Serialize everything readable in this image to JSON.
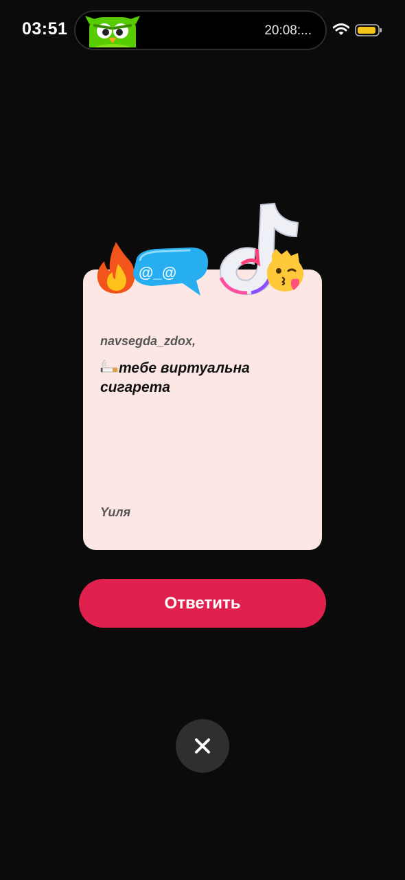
{
  "status_bar": {
    "time": "03:51",
    "island_text": "20:08:...",
    "icons": [
      "owl-icon",
      "wifi-icon",
      "battery-icon"
    ],
    "battery_color": "#f5c518"
  },
  "card": {
    "recipient": "navsegda_zdox,",
    "message": "тебе виртуальна сигарета",
    "message_emoji": "cigarette-emoji",
    "signature": "Yuля",
    "background": "#fde7e4",
    "stickers": [
      "fire-sticker",
      "chat-bubble-sticker",
      "tiktok-note-sticker",
      "kiss-emoji-sticker"
    ],
    "bubble_text": "@_@"
  },
  "actions": {
    "reply_label": "Ответить",
    "reply_color": "#e0214d",
    "close_icon": "close-icon"
  }
}
